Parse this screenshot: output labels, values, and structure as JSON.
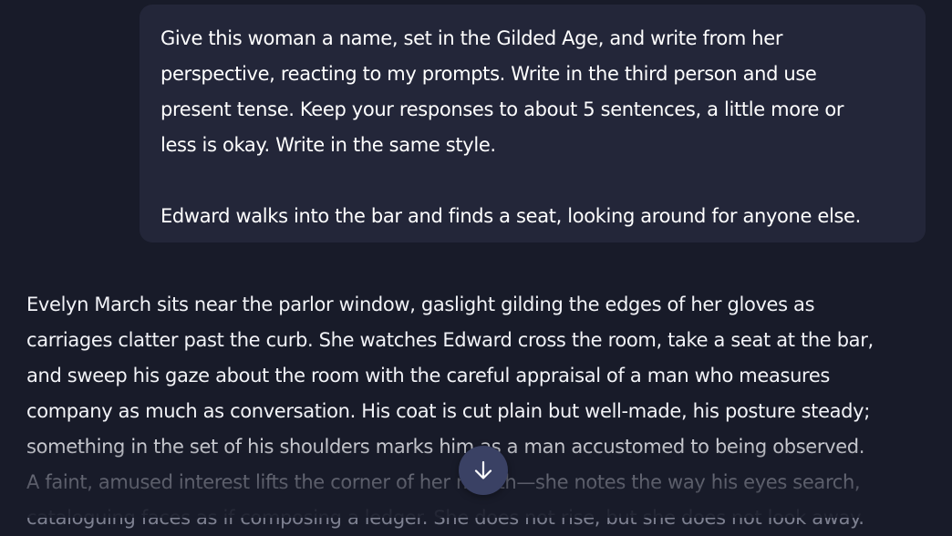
{
  "user_message": {
    "lines": [
      "Give this woman a name, set in the Gilded Age, and write from her",
      "perspective, reacting to my prompts. Write in the third person and use",
      "present tense. Keep your responses to about 5 sentences, a little more or",
      "less is okay. Write in the same style.",
      "Edward walks into the bar and finds a seat, looking around for anyone else."
    ]
  },
  "assistant_message": {
    "lines": [
      "Evelyn March sits near the parlor window, gaslight gilding the edges of her gloves as",
      "carriages clatter past the curb. She watches Edward cross the room, take a seat at the bar,",
      "and sweep his gaze about the room with the careful appraisal of a man who measures",
      "company as much as conversation. His coat is cut plain but well-made, his posture steady;",
      "something in the set of his shoulders marks him as a man accustomed to being observed.",
      "A faint, amused interest lifts the corner of her mouth—she notes the way his eyes search,",
      "cataloguing faces as if composing a ledger. She does not rise, but she does not look away."
    ]
  },
  "scroll_button": {
    "icon": "arrow-down-icon"
  },
  "colors": {
    "background": "#181b29",
    "user_bubble": "#232639",
    "scroll_button": "#3a4164",
    "text": "#f2f3f7"
  }
}
